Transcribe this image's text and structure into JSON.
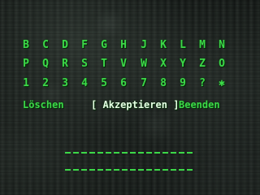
{
  "keyboard": {
    "rows": [
      [
        "B",
        "C",
        "D",
        "F",
        "G",
        "H",
        "J",
        "K",
        "L",
        "M",
        "N"
      ],
      [
        "P",
        "Q",
        "R",
        "S",
        "T",
        "V",
        "W",
        "X",
        "Y",
        "Z",
        "O"
      ],
      [
        "1",
        "2",
        "3",
        "4",
        "5",
        "6",
        "7",
        "8",
        "9",
        "?",
        "✱"
      ]
    ]
  },
  "menu": {
    "delete_label": "Löschen",
    "accept_label": "Akzeptieren",
    "accept_open_bracket": "[",
    "accept_close_bracket": "]",
    "quit_label": "Beenden"
  },
  "entry": {
    "line1_text": "",
    "line2_text": ""
  },
  "colors": {
    "text": "#3cd848",
    "selected": "#e6ffe4"
  }
}
